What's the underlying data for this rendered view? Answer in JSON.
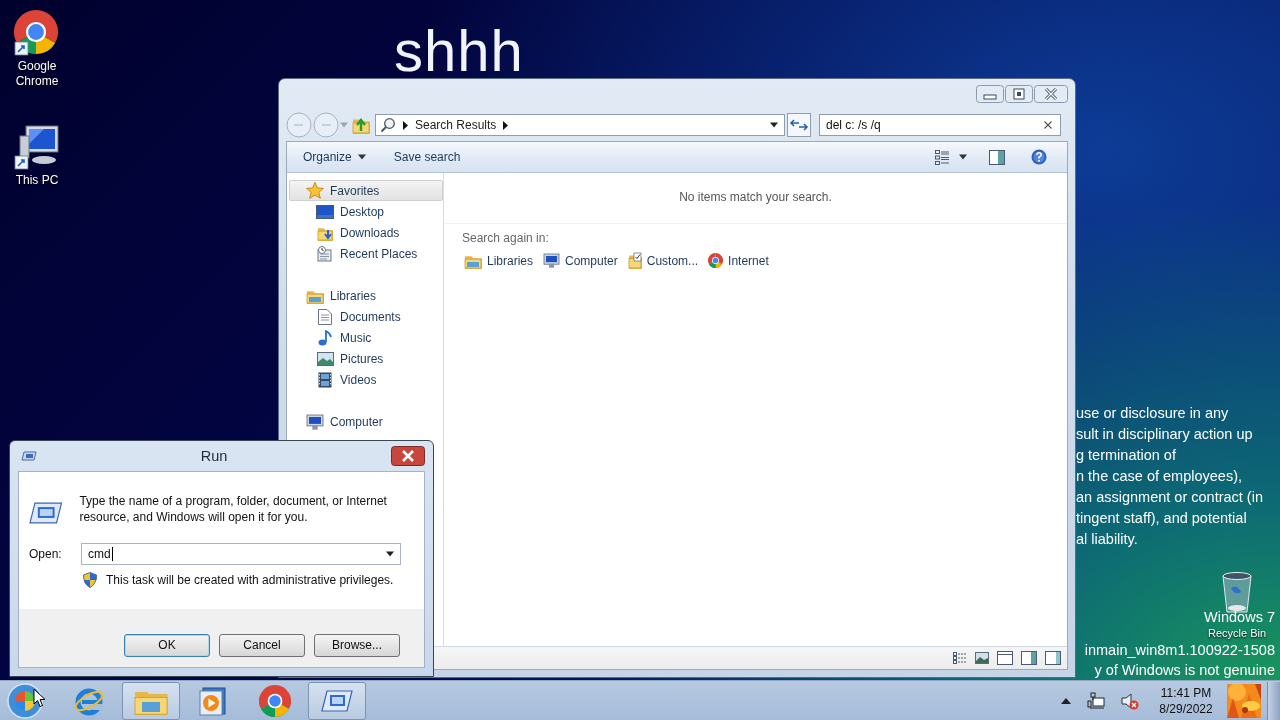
{
  "desktop": {
    "wallpaper_text": "shhh",
    "icons": [
      {
        "label": "Google Chrome"
      },
      {
        "label": "This PC"
      },
      {
        "label": "Recycle Bin"
      }
    ],
    "notice_lines": [
      "use or disclosure in any",
      "sult in disciplinary action up",
      "g termination of",
      "n the case of employees),",
      "an assignment or contract (in",
      "tingent staff), and potential",
      "al liability."
    ],
    "watermark_lines": [
      "Windows 7",
      "inmain_win8m1.100922-1508",
      "y of Windows is not genuine"
    ]
  },
  "explorer": {
    "address": {
      "segments": [
        "Search Results"
      ]
    },
    "search": {
      "value": "del c: /s /q"
    },
    "toolbar": {
      "buttons": [
        "Organize",
        "Save search"
      ]
    },
    "nav": [
      {
        "label": "Favorites",
        "selected": true,
        "children": [
          {
            "label": "Desktop",
            "selected": false
          },
          {
            "label": "Downloads",
            "selected": false
          },
          {
            "label": "Recent Places",
            "selected": false
          }
        ]
      },
      {
        "label": "Libraries",
        "selected": false,
        "children": [
          {
            "label": "Documents",
            "selected": false
          },
          {
            "label": "Music",
            "selected": false
          },
          {
            "label": "Pictures",
            "selected": false
          },
          {
            "label": "Videos",
            "selected": false
          }
        ]
      },
      {
        "label": "Computer",
        "selected": false
      }
    ],
    "empty_message": "No items match your search.",
    "search_again": {
      "label": "Search again in:",
      "locations": [
        "Libraries",
        "Computer",
        "Custom...",
        "Internet"
      ]
    }
  },
  "run_dialog": {
    "title": "Run",
    "description": "Type the name of a program, folder, document, or Internet resource, and Windows will open it for you.",
    "open_label": "Open:",
    "open_value": "cmd",
    "admin_note": "This task will be created with administrative privileges.",
    "buttons": [
      {
        "label": "OK",
        "default": true
      },
      {
        "label": "Cancel",
        "default": false
      },
      {
        "label": "Browse...",
        "default": false
      }
    ]
  },
  "taskbar": {
    "apps": [
      {
        "running": false
      },
      {
        "running": true
      },
      {
        "running": false
      },
      {
        "running": false
      },
      {
        "running": true
      }
    ],
    "clock": {
      "time": "11:41 PM",
      "date": "8/29/2022"
    }
  }
}
